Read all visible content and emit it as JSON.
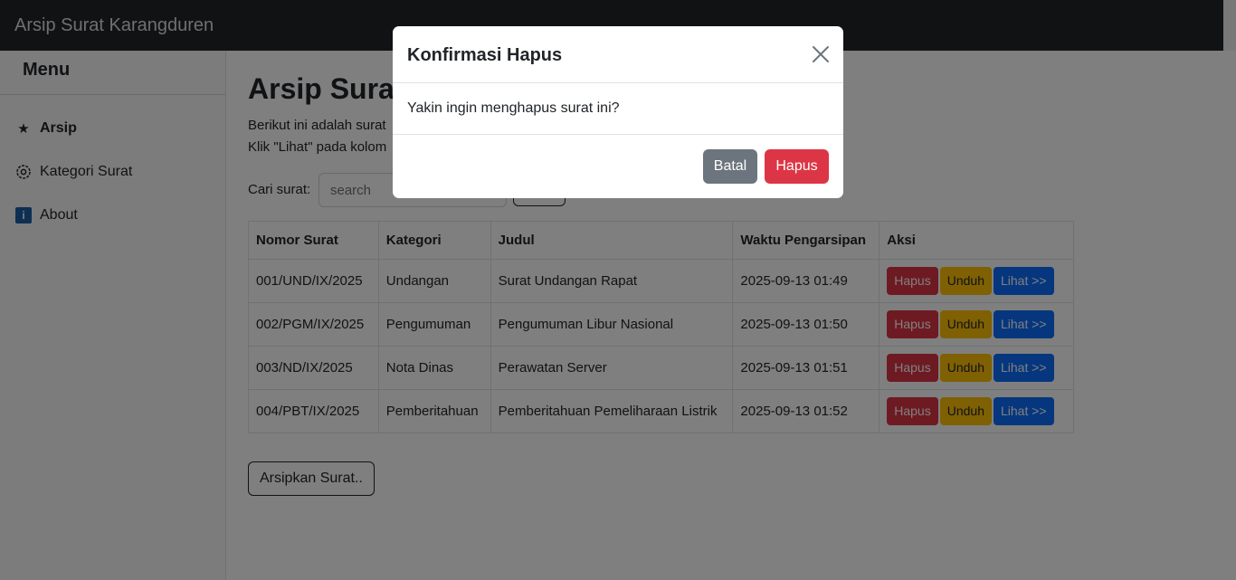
{
  "app": {
    "brand": "Arsip Surat Karangduren"
  },
  "sidebar": {
    "title": "Menu",
    "items": [
      {
        "label": "Arsip",
        "icon": "star-icon"
      },
      {
        "label": "Kategori Surat",
        "icon": "gear-icon"
      },
      {
        "label": "About",
        "icon": "info-icon"
      }
    ]
  },
  "main": {
    "title": "Arsip Surat",
    "desc1": "Berikut ini adalah surat",
    "desc2": "Klik \"Lihat\" pada kolom",
    "search": {
      "label": "Cari surat:",
      "placeholder": "search",
      "button": ""
    },
    "table": {
      "headers": [
        "Nomor Surat",
        "Kategori",
        "Judul",
        "Waktu Pengarsipan",
        "Aksi"
      ],
      "rows": [
        [
          "001/UND/IX/2025",
          "Undangan",
          "Surat Undangan Rapat",
          "2025-09-13 01:49"
        ],
        [
          "002/PGM/IX/2025",
          "Pengumuman",
          "Pengumuman Libur Nasional",
          "2025-09-13 01:50"
        ],
        [
          "003/ND/IX/2025",
          "Nota Dinas",
          "Perawatan Server",
          "2025-09-13 01:51"
        ],
        [
          "004/PBT/IX/2025",
          "Pemberitahuan",
          "Pemberitahuan Pemeliharaan Listrik",
          "2025-09-13 01:52"
        ]
      ],
      "actions": {
        "hapus": "Hapus",
        "unduh": "Unduh",
        "lihat": "Lihat >>"
      }
    },
    "arsip_button": "Arsipkan Surat.."
  },
  "modal": {
    "title": "Konfirmasi Hapus",
    "body": "Yakin ingin menghapus surat ini?",
    "cancel": "Batal",
    "confirm": "Hapus"
  },
  "colors": {
    "navbar": "#212529",
    "danger": "#dc3545",
    "warning": "#ffc107",
    "primary": "#0d6efd",
    "secondary": "#6c757d"
  }
}
